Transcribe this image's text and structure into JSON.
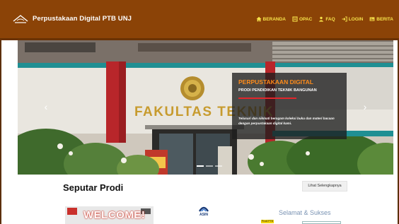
{
  "brand": {
    "title": "Perpustakaan Digital PTB UNJ"
  },
  "nav": {
    "items": [
      {
        "label": "BERANDA",
        "icon": "home-icon"
      },
      {
        "label": "OPAC",
        "icon": "book-icon"
      },
      {
        "label": "FAQ",
        "icon": "users-icon"
      },
      {
        "label": "LOGIN",
        "icon": "login-icon"
      },
      {
        "label": "BERITA",
        "icon": "newspaper-icon"
      }
    ]
  },
  "carousel": {
    "building_sign": "FAKULTAS TEKNIK",
    "caption": {
      "title": "PERPUSTAKAAN DIGITAL",
      "subtitle": "PRODI PENDIDIKAN TEKNIK BANGUNAN",
      "text": "Telusuri dan nikmati beragam koleksi buku dan materi bacaan dengan perpustakaan digital kami."
    },
    "prev_glyph": "‹",
    "next_glyph": "›",
    "slide_count": 3,
    "active_slide": 1
  },
  "section": {
    "title": "Seputar Prodi",
    "see_more_label": "Lihat Selengkapnya"
  },
  "cards": {
    "welcome_text": "WELCOME!",
    "asin_label": "ASIN",
    "selamat_text": "Selamat & Sukses",
    "prodi_tag": "Prodi PTB"
  },
  "colors": {
    "navbar": "#8b4307",
    "nav_text": "#f6e24a",
    "caption_title": "#ff8c1a",
    "caption_rule": "#e2262b"
  }
}
